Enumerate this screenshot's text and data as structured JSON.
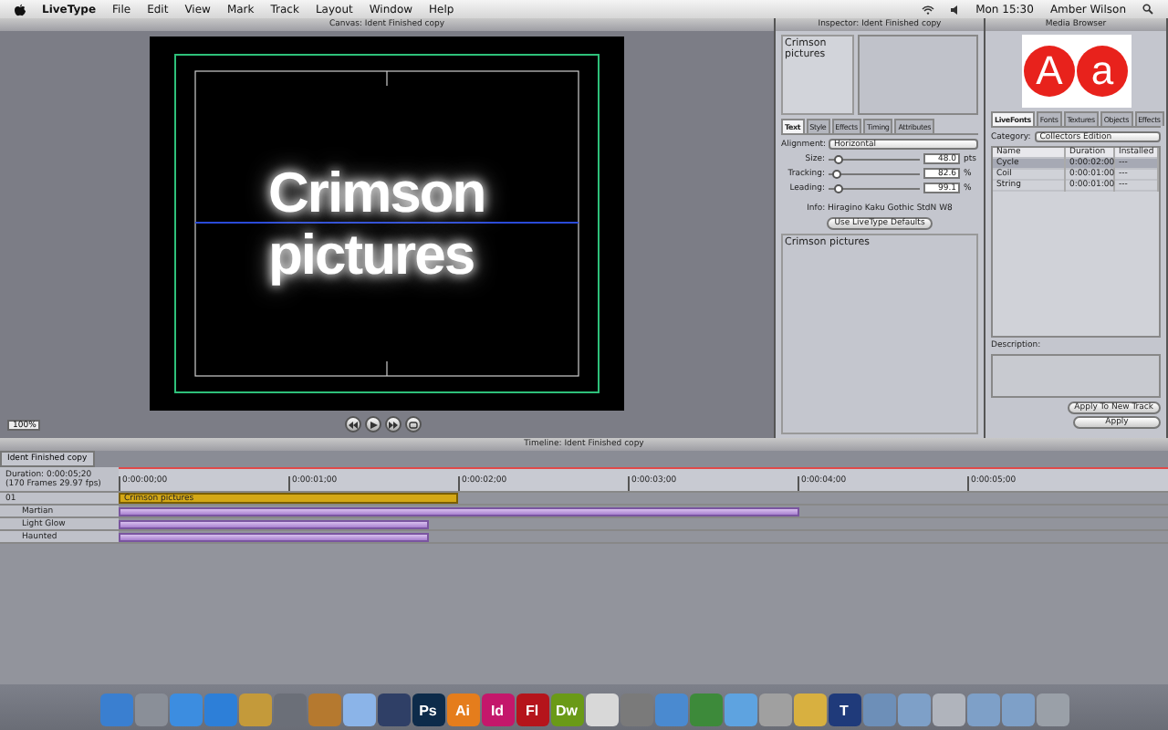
{
  "menu_bar": {
    "app": "LiveType",
    "items": [
      "File",
      "Edit",
      "View",
      "Mark",
      "Track",
      "Layout",
      "Window",
      "Help"
    ],
    "clock": "Mon 15:30",
    "user": "Amber Wilson"
  },
  "canvas": {
    "title": "Canvas: Ident Finished copy",
    "text": "Crimson pictures",
    "zoom": "100%"
  },
  "inspector": {
    "title": "Inspector: Ident Finished copy",
    "preview_text": "Crimson pictures",
    "tabs": [
      {
        "label": "Text",
        "selected": true
      },
      {
        "label": "Style",
        "selected": false
      },
      {
        "label": "Effects",
        "selected": false
      },
      {
        "label": "Timing",
        "selected": false
      },
      {
        "label": "Attributes",
        "selected": false
      }
    ],
    "alignment_label": "Alignment:",
    "alignment": "Horizontal",
    "sliders": [
      {
        "label": "Size:",
        "value": "48.0",
        "unit": "pts",
        "level": 0.05
      },
      {
        "label": "Tracking:",
        "value": "82.6",
        "unit": "%",
        "level": 0.03
      },
      {
        "label": "Leading:",
        "value": "99.1",
        "unit": "%",
        "level": 0.06
      }
    ],
    "info": "Info: Hiragino Kaku Gothic StdN W8",
    "defaults_button": "Use LiveType Defaults",
    "text_field": "Crimson pictures"
  },
  "media_browser": {
    "title": "Media Browser",
    "logo": [
      "A",
      "a"
    ],
    "tabs": [
      {
        "label": "LiveFonts",
        "selected": true
      },
      {
        "label": "Fonts",
        "selected": false
      },
      {
        "label": "Textures",
        "selected": false
      },
      {
        "label": "Objects",
        "selected": false
      },
      {
        "label": "Effects",
        "selected": false
      }
    ],
    "category_label": "Category:",
    "category": "Collectors Edition",
    "columns": [
      "Name",
      "Duration",
      "Installed"
    ],
    "rows": [
      {
        "name": "Cycle",
        "duration": "0:00:02:00",
        "installed": "---",
        "selected": true
      },
      {
        "name": "Coil",
        "duration": "0:00:01:00",
        "installed": "---",
        "selected": false
      },
      {
        "name": "String",
        "duration": "0:00:01:00",
        "installed": "---",
        "selected": false
      }
    ],
    "description_label": "Description:",
    "buttons": [
      "Apply To New Track",
      "Apply"
    ]
  },
  "timeline": {
    "title": "Timeline: Ident Finished copy",
    "tab": "Ident Finished copy",
    "duration": "Duration: 0:00:05;20",
    "frames": "(170 Frames 29.97 fps)",
    "ruler": [
      "0:00:00;00",
      "0:00:01;00",
      "0:00:02;00",
      "0:00:03;00",
      "0:00:04;00",
      "0:00:05;00"
    ],
    "track": "01",
    "clip": "Crimson pictures",
    "effects": [
      "Martian",
      "Light Glow",
      "Haunted"
    ]
  },
  "dock": [
    {
      "kind": "icon",
      "color": "#3a7fd0"
    },
    {
      "kind": "icon",
      "color": "#8a8f98"
    },
    {
      "kind": "icon",
      "color": "#3c8de0"
    },
    {
      "kind": "icon",
      "color": "#2d7fd8"
    },
    {
      "kind": "icon",
      "color": "#c49a3a"
    },
    {
      "kind": "icon",
      "color": "#6b6f78"
    },
    {
      "kind": "icon",
      "color": "#b5792f"
    },
    {
      "kind": "icon",
      "color": "#8bb4e8"
    },
    {
      "kind": "icon",
      "color": "#2f3f66"
    },
    {
      "kind": "letter",
      "label": "Ps",
      "color": "#0d2b4a"
    },
    {
      "kind": "letter",
      "label": "Ai",
      "color": "#e57d1c"
    },
    {
      "kind": "letter",
      "label": "Id",
      "color": "#c4176b"
    },
    {
      "kind": "letter",
      "label": "Fl",
      "color": "#b5141b"
    },
    {
      "kind": "letter",
      "label": "Dw",
      "color": "#6a9a17"
    },
    {
      "kind": "icon",
      "color": "#d8d8d8"
    },
    {
      "kind": "icon",
      "color": "#7a7a7a"
    },
    {
      "kind": "icon",
      "color": "#4a8ad0"
    },
    {
      "kind": "icon",
      "color": "#3d8a3a"
    },
    {
      "kind": "icon",
      "color": "#5ea3e0"
    },
    {
      "kind": "icon",
      "color": "#a0a0a0"
    },
    {
      "kind": "icon",
      "color": "#d8b040"
    },
    {
      "kind": "letter",
      "label": "T",
      "color": "#1f3a7a"
    },
    {
      "kind": "icon",
      "color": "#6d8fb8"
    },
    {
      "kind": "icon",
      "color": "#7ea0c8"
    },
    {
      "kind": "icon",
      "color": "#b0b4bc"
    },
    {
      "kind": "icon",
      "color": "#7ea0c8"
    },
    {
      "kind": "icon",
      "color": "#7ea0c8"
    },
    {
      "kind": "icon",
      "color": "#9aa0a8"
    }
  ]
}
